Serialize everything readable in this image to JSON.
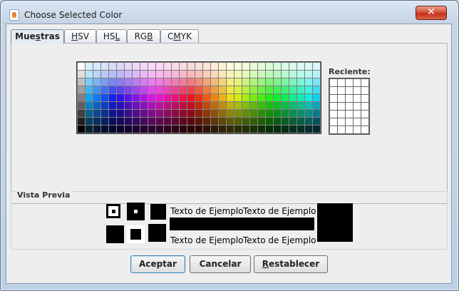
{
  "window": {
    "title": "Choose Selected Color",
    "close_symbol": "✕"
  },
  "tabs": [
    {
      "pre": "Mue",
      "u": "s",
      "post": "tras",
      "active": true
    },
    {
      "pre": "",
      "u": "H",
      "post": "SV",
      "active": false
    },
    {
      "pre": "HS",
      "u": "L",
      "post": "",
      "active": false
    },
    {
      "pre": "RG",
      "u": "B",
      "post": "",
      "active": false
    },
    {
      "pre": "C",
      "u": "M",
      "post": "YK",
      "active": false
    }
  ],
  "swatches": {
    "recent_label": "Reciente:",
    "rows": 9,
    "columns": 31
  },
  "preview": {
    "title": "Vista Previa",
    "sample_texts": [
      "Texto de Ejemplo",
      "Texto de Ejemplo",
      "Texto de Ejemplo",
      "Texto de Ejemplo"
    ],
    "selected_color": "#000000"
  },
  "buttons": {
    "accept": {
      "pre": "Aceptar",
      "u": "",
      "post": ""
    },
    "cancel": {
      "pre": "Cancelar",
      "u": "",
      "post": ""
    },
    "reset": {
      "pre": "",
      "u": "R",
      "post": "establecer"
    }
  },
  "icons": {
    "app": "java-cup-icon",
    "close": "close-icon"
  }
}
